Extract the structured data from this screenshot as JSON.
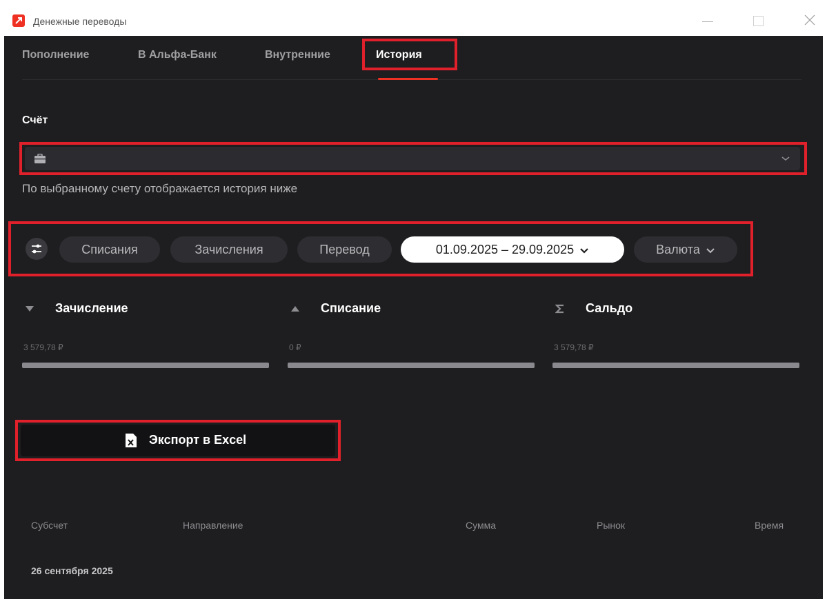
{
  "window": {
    "title": "Денежные переводы"
  },
  "tabs": [
    {
      "label": "Пополнение"
    },
    {
      "label": "В Альфа-Банк"
    },
    {
      "label": "Внутренние"
    },
    {
      "label": "История",
      "active": true
    }
  ],
  "account": {
    "label": "Счёт",
    "selected_value": "",
    "hint": "По выбранному счету отображается история ниже"
  },
  "filters": {
    "chips": [
      {
        "label": "Списания"
      },
      {
        "label": "Зачисления"
      },
      {
        "label": "Перевод"
      }
    ],
    "date_range": "01.09.2025 – 29.09.2025",
    "currency": "Валюта"
  },
  "summary": [
    {
      "title": "Зачисление",
      "value": "3 579,78 ₽",
      "icon": "triangle-down-icon"
    },
    {
      "title": "Списание",
      "value": "0 ₽",
      "icon": "triangle-up-icon"
    },
    {
      "title": "Сальдо",
      "value": "3 579,78 ₽",
      "icon": "sigma-icon"
    }
  ],
  "export": {
    "label": "Экспорт в Excel",
    "icon": "excel-icon"
  },
  "table": {
    "columns": [
      "Субсчет",
      "Направление",
      "Сумма",
      "Рынок",
      "Время"
    ],
    "date_group": "26 сентября 2025"
  },
  "colors": {
    "accent": "#ef3124",
    "highlight_box": "#e0202a",
    "panel_bg": "#1e1e20"
  }
}
